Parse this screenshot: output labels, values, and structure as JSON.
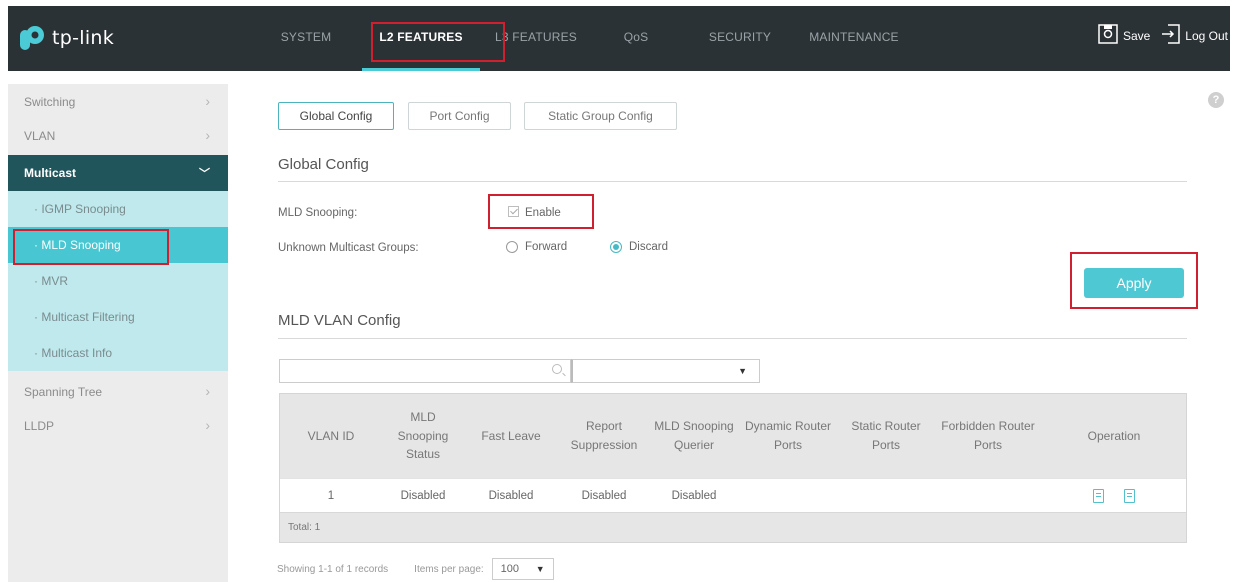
{
  "brand": {
    "name": "tp-link",
    "accent": "#4acbd6",
    "highlight": "#d0202f"
  },
  "nav": {
    "items": [
      "SYSTEM",
      "L2 FEATURES",
      "L3 FEATURES",
      "QoS",
      "SECURITY",
      "MAINTENANCE"
    ],
    "active": "L2 FEATURES"
  },
  "top_actions": {
    "save": "Save",
    "logout": "Log Out"
  },
  "sidebar": {
    "items": [
      {
        "label": "Switching"
      },
      {
        "label": "VLAN"
      },
      {
        "label": "Multicast"
      },
      {
        "label": "· IGMP Snooping"
      },
      {
        "label": "· MLD Snooping"
      },
      {
        "label": "· MVR"
      },
      {
        "label": "· Multicast Filtering"
      },
      {
        "label": "· Multicast Info"
      },
      {
        "label": "Spanning Tree"
      },
      {
        "label": "LLDP"
      }
    ]
  },
  "tabs": [
    "Global Config",
    "Port Config",
    "Static Group Config"
  ],
  "global_config": {
    "title": "Global Config",
    "mld_label": "MLD Snooping:",
    "enable_label": "Enable",
    "unknown_label": "Unknown Multicast Groups:",
    "forward_label": "Forward",
    "discard_label": "Discard",
    "selected": "Discard",
    "apply_label": "Apply"
  },
  "vlan_config": {
    "title": "MLD VLAN Config",
    "columns": [
      "VLAN ID",
      "MLD Snooping Status",
      "Fast Leave",
      "Report Suppression",
      "MLD Snooping Querier",
      "Dynamic Router Ports",
      "Static Router Ports",
      "Forbidden Router Ports",
      "Operation"
    ],
    "rows": [
      [
        "1",
        "Disabled",
        "Disabled",
        "Disabled",
        "Disabled",
        "",
        "",
        "",
        ""
      ]
    ],
    "total": "Total: 1",
    "showing": "Showing 1-1 of 1 records",
    "items_per_page_label": "Items per page:",
    "items_per_page": "100"
  }
}
